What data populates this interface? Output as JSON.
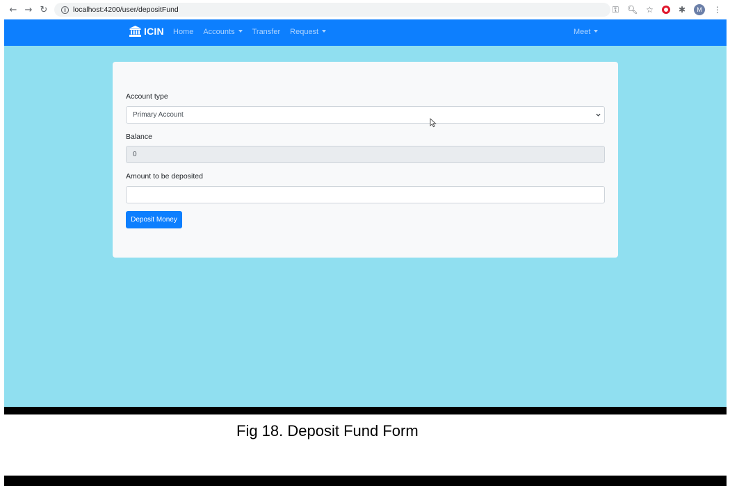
{
  "browser": {
    "url": "localhost:4200/user/depositFund",
    "avatar_letter": "M"
  },
  "navbar": {
    "brand": "ICIN",
    "links": [
      {
        "label": "Home"
      },
      {
        "label": "Accounts"
      },
      {
        "label": "Transfer"
      },
      {
        "label": "Request"
      }
    ],
    "user": "Meet"
  },
  "form": {
    "account_type_label": "Account type",
    "account_type_value": "Primary Account",
    "balance_label": "Balance",
    "balance_value": "0",
    "amount_label": "Amount to be deposited",
    "amount_value": "",
    "submit_label": "Deposit Money"
  },
  "caption": "Fig 18. Deposit Fund Form",
  "colors": {
    "navbar": "#0d7ffe",
    "background": "#90dff0",
    "button": "#0d7ffe"
  }
}
